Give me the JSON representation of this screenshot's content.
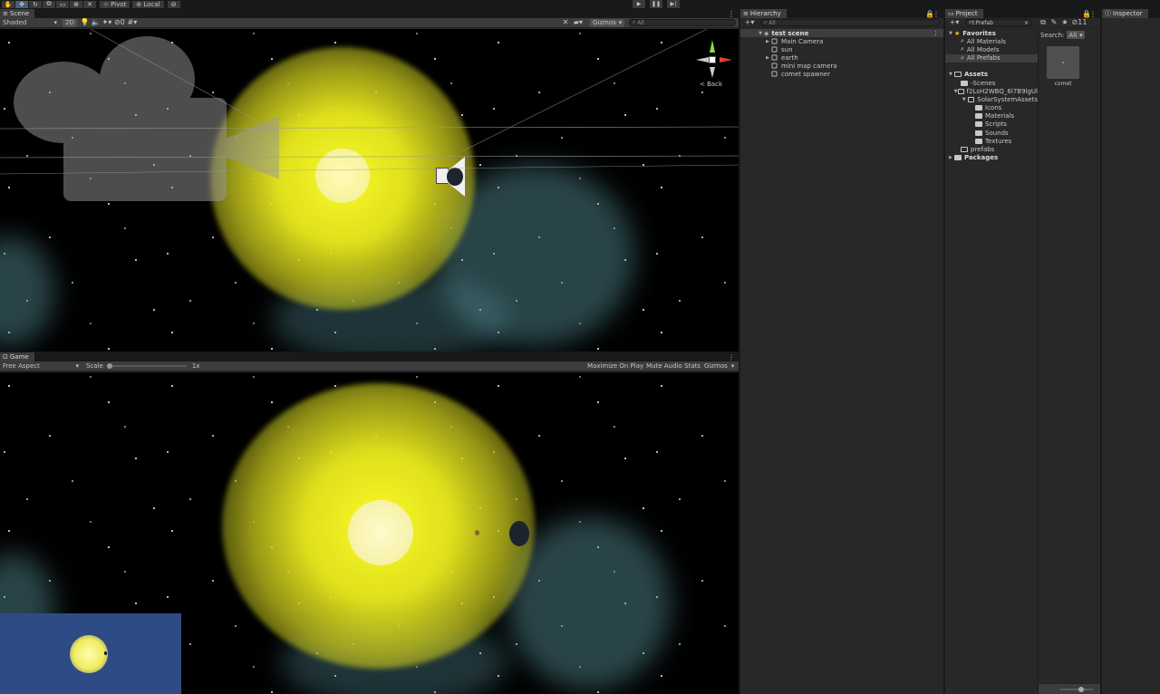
{
  "toolbar": {
    "pivot_label": "Pivot",
    "local_label": "Local"
  },
  "scene": {
    "tab_label": "Scene",
    "shading_mode": "Shaded",
    "mode_2d": "2D",
    "hidden_count": "0",
    "gizmos_label": "Gizmos",
    "search_placeholder": "All",
    "orientation_label": "Back"
  },
  "game": {
    "tab_label": "Game",
    "aspect": "Free Aspect",
    "scale_label": "Scale",
    "scale_value": "1x",
    "scale_fraction": 0.0,
    "maximize_label": "Maximize On Play",
    "mute_label": "Mute Audio",
    "stats_label": "Stats",
    "gizmos_label": "Gizmos"
  },
  "hierarchy": {
    "tab_label": "Hierarchy",
    "search_placeholder": "All",
    "scene_name": "test scene",
    "items": [
      {
        "label": "Main Camera",
        "expandable": true
      },
      {
        "label": "sun",
        "expandable": false
      },
      {
        "label": "earth",
        "expandable": true
      },
      {
        "label": "mini map camera",
        "expandable": false
      },
      {
        "label": "comet spawner",
        "expandable": false
      }
    ]
  },
  "project": {
    "tab_label": "Project",
    "search_value": "t:Prefab",
    "search_label": "Search:",
    "search_scope": "All",
    "hidden_count": "11",
    "favorites_label": "Favorites",
    "favorites": [
      "All Materials",
      "All Models",
      "All Prefabs"
    ],
    "assets_label": "Assets",
    "assets_tree": [
      {
        "label": "-Scenes",
        "depth": 1
      },
      {
        "label": "f2LsH2WBQ_6l7B9lgUl",
        "depth": 1
      },
      {
        "label": "SolarSystemAssets",
        "depth": 2
      },
      {
        "label": "Icons",
        "depth": 3
      },
      {
        "label": "Materials",
        "depth": 3
      },
      {
        "label": "Scripts",
        "depth": 3
      },
      {
        "label": "Sounds",
        "depth": 3
      },
      {
        "label": "Textures",
        "depth": 3
      },
      {
        "label": "prefabs",
        "depth": 1
      }
    ],
    "packages_label": "Packages",
    "asset_name": "comet"
  },
  "inspector": {
    "tab_label": "Inspector"
  },
  "colors": {
    "accent": "#46607c",
    "panel": "#282828",
    "toolbar": "#3c3c3c",
    "minimap_bg": "#2f4b86"
  }
}
